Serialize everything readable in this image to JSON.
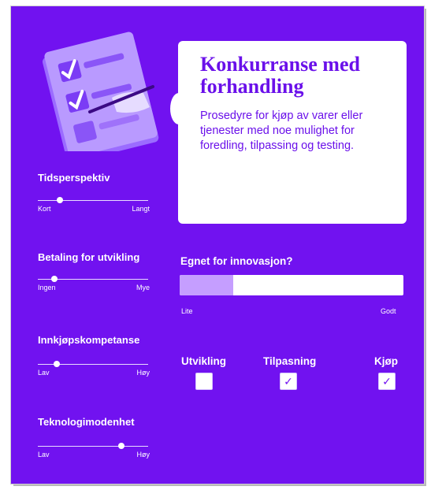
{
  "info": {
    "title": "Konkurranse med forhandling",
    "description": "Prosedyre for kjøp av varer eller tjenester med noe mulighet for foredling, tilpassing og testing."
  },
  "sliders": [
    {
      "title": "Tidsperspektiv",
      "min_label": "Kort",
      "max_label": "Langt",
      "value": 0.2
    },
    {
      "title": "Betaling for utvikling",
      "min_label": "Ingen",
      "max_label": "Mye",
      "value": 0.15
    },
    {
      "title": "Innkjøpskompetanse",
      "min_label": "Lav",
      "max_label": "Høy",
      "value": 0.17
    },
    {
      "title": "Teknologimodenhet",
      "min_label": "Lav",
      "max_label": "Høy",
      "value": 0.76
    }
  ],
  "innovation": {
    "title": "Egnet for innovasjon?",
    "low_label": "Lite",
    "high_label": "Godt",
    "level": 0.24
  },
  "options": [
    {
      "label": "Utvikling",
      "checked": false
    },
    {
      "label": "Tilpasning",
      "checked": true
    },
    {
      "label": "Kjøp",
      "checked": true
    }
  ],
  "colors": {
    "background": "#7112f0",
    "accent_text": "#6a10ea",
    "bar_fill": "#c59eff"
  },
  "icons": {
    "illustration": "checklist-illustration-icon",
    "check": "checkmark-icon"
  }
}
